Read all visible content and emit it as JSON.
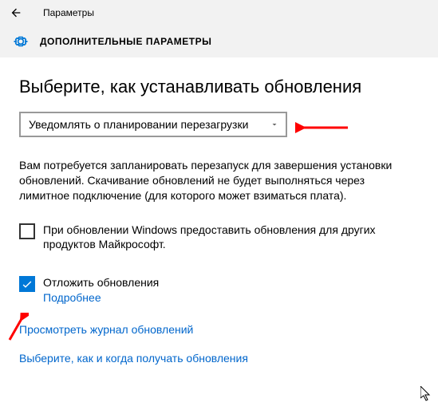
{
  "header": {
    "app_title": "Параметры",
    "page_name": "ДОПОЛНИТЕЛЬНЫЕ ПАРАМЕТРЫ"
  },
  "main": {
    "heading": "Выберите, как устанавливать обновления",
    "dropdown_value": "Уведомлять о планировании перезагрузки",
    "description": "Вам потребуется запланировать перезапуск для завершения установки обновлений. Скачивание обновлений не будет выполняться через лимитное подключение (для которого может взиматься плата).",
    "checkbox1": {
      "checked": false,
      "label": "При обновлении Windows предоставить обновления для других продуктов Майкрософт."
    },
    "checkbox2": {
      "checked": true,
      "label": "Отложить обновления",
      "more_link": "Подробнее"
    },
    "link_history": "Просмотреть журнал обновлений",
    "link_schedule": "Выберите, как и когда получать обновления"
  },
  "colors": {
    "accent": "#0078d7",
    "link": "#0066cc",
    "arrow": "#ff0000"
  }
}
